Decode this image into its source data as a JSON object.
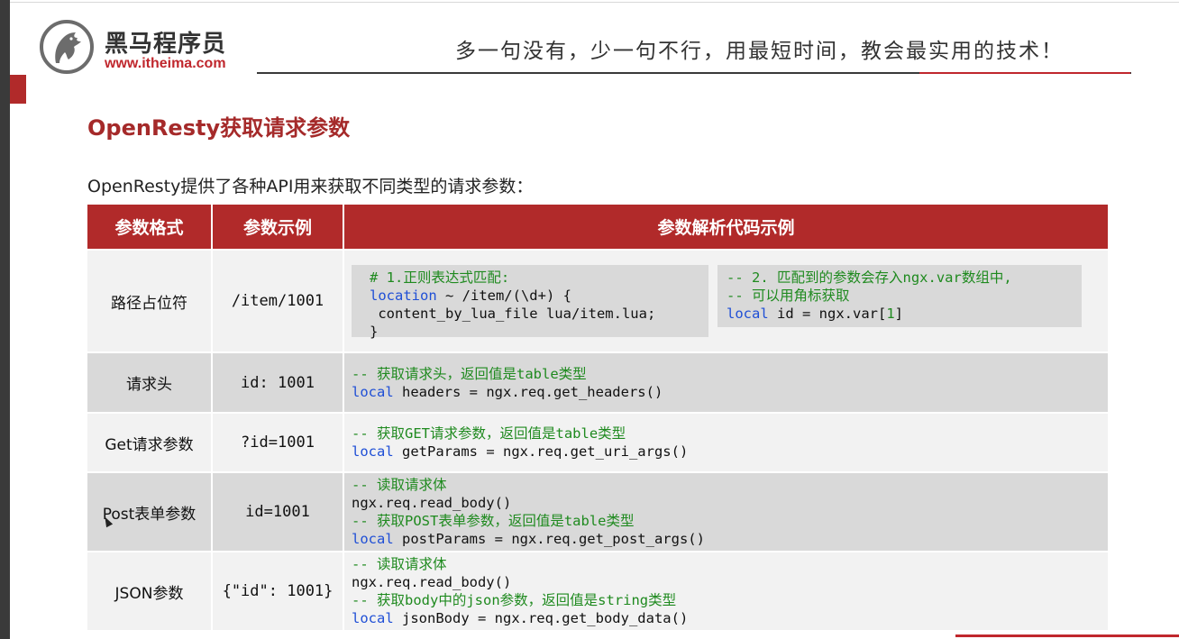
{
  "brand": {
    "name": "黑马程序员",
    "url": "www.itheima.com"
  },
  "slogan": "多一句没有，少一句不行，用最短时间，教会最实用的技术！",
  "title": "OpenResty获取请求参数",
  "intro": "OpenResty提供了各种API用来获取不同类型的请求参数：",
  "table": {
    "headers": [
      "参数格式",
      "参数示例",
      "参数解析代码示例"
    ],
    "rows": [
      {
        "format": "路径占位符",
        "example": "/item/1001",
        "code_a": {
          "line1": "# 1.正则表达式匹配:",
          "line2_kw": "location",
          "line2_rest": " ~ /item/(\\d+) {",
          "line3": " content_by_lua_file lua/item.lua;",
          "line4": "}"
        },
        "code_b": {
          "line1": "-- 2. 匹配到的参数会存入ngx.var数组中,",
          "line2": "-- 可以用角标获取",
          "line3_kw": "local",
          "line3_rest": " id = ngx.var[",
          "line3_num": "1",
          "line3_end": "]"
        }
      },
      {
        "format": "请求头",
        "example": "id: 1001",
        "comment": "-- 获取请求头，返回值是table类型",
        "kw": "local",
        "code": " headers = ngx.req.get_headers()"
      },
      {
        "format": "Get请求参数",
        "example": "?id=1001",
        "comment": "-- 获取GET请求参数，返回值是table类型",
        "kw": "local",
        "code": " getParams = ngx.req.get_uri_args()"
      },
      {
        "format": "Post表单参数",
        "example": "id=1001",
        "comment1": "-- 读取请求体",
        "line2": "ngx.req.read_body()",
        "comment2": "-- 获取POST表单参数，返回值是table类型",
        "kw": "local",
        "code": " postParams = ngx.req.get_post_args()"
      },
      {
        "format": "JSON参数",
        "example": "{\"id\": 1001}",
        "comment1": "-- 读取请求体",
        "line2": "ngx.req.read_body()",
        "comment2": "-- 获取body中的json参数，返回值是string类型",
        "kw": "local",
        "code": " jsonBody = ngx.req.get_body_data()"
      }
    ]
  },
  "colors": {
    "accent": "#b12a2a",
    "comment": "#1f8a1f",
    "keyword": "#1f4fd6"
  }
}
